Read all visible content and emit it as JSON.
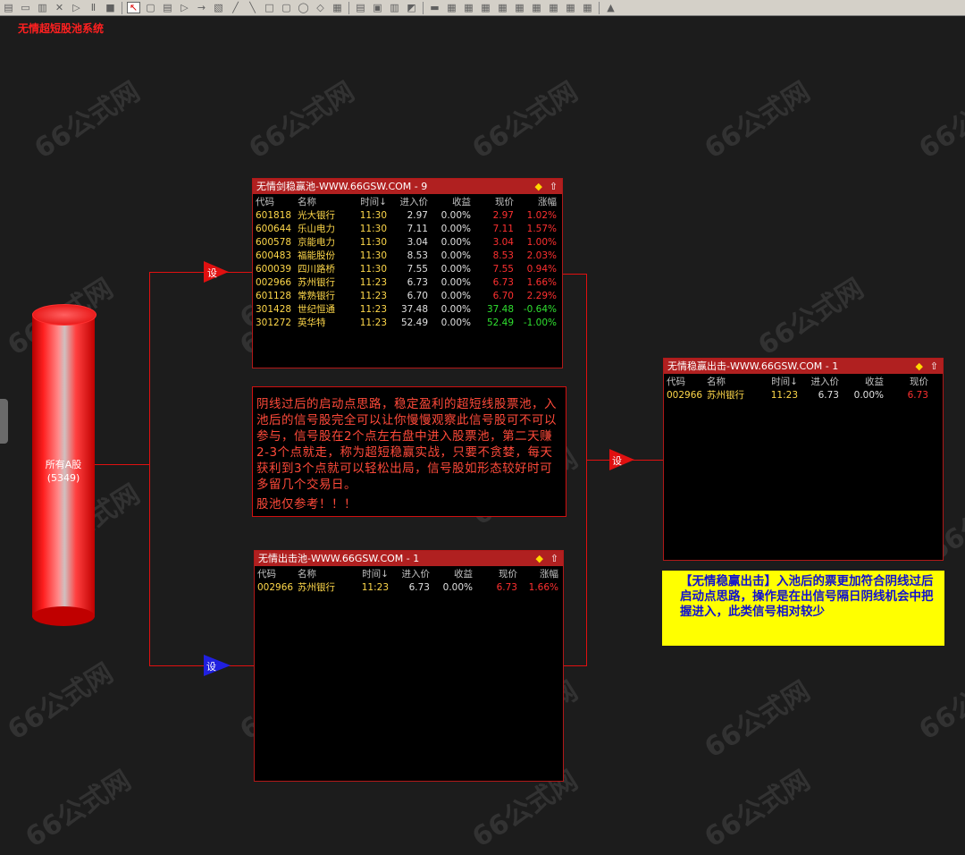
{
  "toolbar": {
    "icons": [
      "new-icon",
      "open-icon",
      "save-icon",
      "delete-icon",
      "play-icon",
      "pause-icon",
      "stop-icon",
      "pointer-icon",
      "rect-icon",
      "doc-icon",
      "arrow-icon",
      "long-arrow-icon",
      "copy-icon",
      "line-icon",
      "diag-icon",
      "square-icon",
      "round-icon",
      "ellipse-icon",
      "shape-icon",
      "table-icon",
      "page-icon",
      "page2-icon",
      "trash-icon",
      "paint-icon",
      "bar-icon",
      "grid1-icon",
      "grid2-icon",
      "grid3-icon",
      "grid4-icon",
      "grid5-icon",
      "grid6-icon",
      "grid7-icon",
      "grid8-icon",
      "grid9-icon",
      "grid10-icon"
    ]
  },
  "system_title": "无情超短股池系统",
  "watermark": "66公式网",
  "source": {
    "label": "所有A股",
    "count": "(5349)"
  },
  "setting_label": "设",
  "pool_main": {
    "title": "无情剑稳赢池-WWW.66GSW.COM - 9",
    "columns": [
      "代码",
      "名称",
      "时间↓",
      "进入价",
      "收益",
      "现价",
      "涨幅"
    ],
    "rows": [
      {
        "code": "601818",
        "name": "光大银行",
        "time": "11:30",
        "entry": "2.97",
        "gain": "0.00%",
        "price": "2.97",
        "change": "1.02%",
        "dir": "up"
      },
      {
        "code": "600644",
        "name": "乐山电力",
        "time": "11:30",
        "entry": "7.11",
        "gain": "0.00%",
        "price": "7.11",
        "change": "1.57%",
        "dir": "up"
      },
      {
        "code": "600578",
        "name": "京能电力",
        "time": "11:30",
        "entry": "3.04",
        "gain": "0.00%",
        "price": "3.04",
        "change": "1.00%",
        "dir": "up"
      },
      {
        "code": "600483",
        "name": "福能股份",
        "time": "11:30",
        "entry": "8.53",
        "gain": "0.00%",
        "price": "8.53",
        "change": "2.03%",
        "dir": "up"
      },
      {
        "code": "600039",
        "name": "四川路桥",
        "time": "11:30",
        "entry": "7.55",
        "gain": "0.00%",
        "price": "7.55",
        "change": "0.94%",
        "dir": "up"
      },
      {
        "code": "002966",
        "name": "苏州银行",
        "time": "11:23",
        "entry": "6.73",
        "gain": "0.00%",
        "price": "6.73",
        "change": "1.66%",
        "dir": "up"
      },
      {
        "code": "601128",
        "name": "常熟银行",
        "time": "11:23",
        "entry": "6.70",
        "gain": "0.00%",
        "price": "6.70",
        "change": "2.29%",
        "dir": "up"
      },
      {
        "code": "301428",
        "name": "世纪恒通",
        "time": "11:23",
        "entry": "37.48",
        "gain": "0.00%",
        "price": "37.48",
        "change": "-0.64%",
        "dir": "down"
      },
      {
        "code": "301272",
        "name": "英华特",
        "time": "11:23",
        "entry": "52.49",
        "gain": "0.00%",
        "price": "52.49",
        "change": "-1.00%",
        "dir": "down"
      }
    ]
  },
  "pool_exit": {
    "title": "无情出击池-WWW.66GSW.COM - 1",
    "columns": [
      "代码",
      "名称",
      "时间↓",
      "进入价",
      "收益",
      "现价",
      "涨幅"
    ],
    "rows": [
      {
        "code": "002966",
        "name": "苏州银行",
        "time": "11:23",
        "entry": "6.73",
        "gain": "0.00%",
        "price": "6.73",
        "change": "1.66%",
        "dir": "up"
      }
    ]
  },
  "pool_final": {
    "title": "无情稳赢出击-WWW.66GSW.COM - 1",
    "columns": [
      "代码",
      "名称",
      "时间↓",
      "进入价",
      "收益",
      "现价"
    ],
    "rows": [
      {
        "code": "002966",
        "name": "苏州银行",
        "time": "11:23",
        "entry": "6.73",
        "gain": "0.00%",
        "price": "6.73",
        "dir": "up"
      }
    ]
  },
  "note": {
    "text": "阴线过后的启动点思路，稳定盈利的超短线股票池，入池后的信号股完全可以让你慢慢观察此信号股可不可以参与，信号股在2个点左右盘中进入股票池，第二天赚2-3个点就走，称为超短稳赢实战，只要不贪婪，每天获利到3个点就可以轻松出局，信号股如形态较好时可多留几个交易日。",
    "footer": "股池仅参考！！！"
  },
  "yellow_note": {
    "text": "【无情稳赢出击】入池后的票更加符合阴线过后启动点思路，操作是在出信号隔日阴线机会中把握进入，此类信号相对较少"
  },
  "colors": {
    "background": "#1c1c1c",
    "line": "#e01010",
    "header": "#b02020",
    "up": "#ff3030",
    "down": "#30e030",
    "code": "#ffd84a",
    "note_bg": "#ffff00",
    "note_text": "#1010d0"
  }
}
